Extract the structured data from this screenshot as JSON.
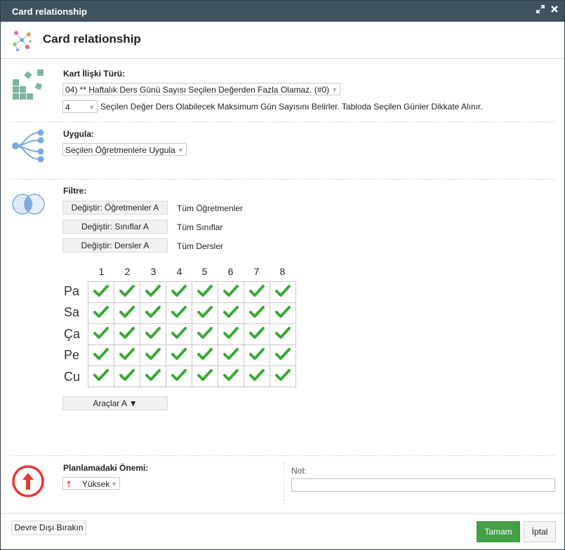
{
  "window": {
    "title": "Card relationship",
    "header_title": "Card relationship"
  },
  "relationship": {
    "label": "Kart İlişki Türü:",
    "type_value": "04) ** Haftalık Ders Günü Sayısı Seçilen Değerden Fazla Olamaz. (#0)",
    "count_value": "4",
    "description": "Seçilen Değer Ders Olabilecek Maksimum Gün Sayısını Belirler. Tabloda Seçilen Günler Dikkate Alınır."
  },
  "apply": {
    "label": "Uygula:",
    "value": "Seçilen Öğretmenlere Uygula"
  },
  "filter": {
    "label": "Filtre:",
    "rows": [
      {
        "button": "Değiştir: Öğretmenler A",
        "value": "Tüm Öğretmenler"
      },
      {
        "button": "Değiştir: Sınıflar A",
        "value": "Tüm Sınıflar"
      },
      {
        "button": "Değiştir: Dersler A",
        "value": "Tüm Dersler"
      }
    ]
  },
  "grid": {
    "columns": [
      "1",
      "2",
      "3",
      "4",
      "5",
      "6",
      "7",
      "8"
    ],
    "rows": [
      "Pa",
      "Sa",
      "Ça",
      "Pe",
      "Cu"
    ],
    "all_checked": true,
    "check_color": "#3aa935"
  },
  "tools_button": "Araçlar A ▼",
  "importance": {
    "label": "Planlamadaki Önemi:",
    "value": "Yüksek",
    "icon_color": "#e53935"
  },
  "note": {
    "label": "Not:",
    "value": ""
  },
  "footer": {
    "disable_button": "Devre Dışı Bırakın",
    "ok_button": "Tamam",
    "cancel_button": "İptal",
    "ok_color": "#43a047"
  }
}
